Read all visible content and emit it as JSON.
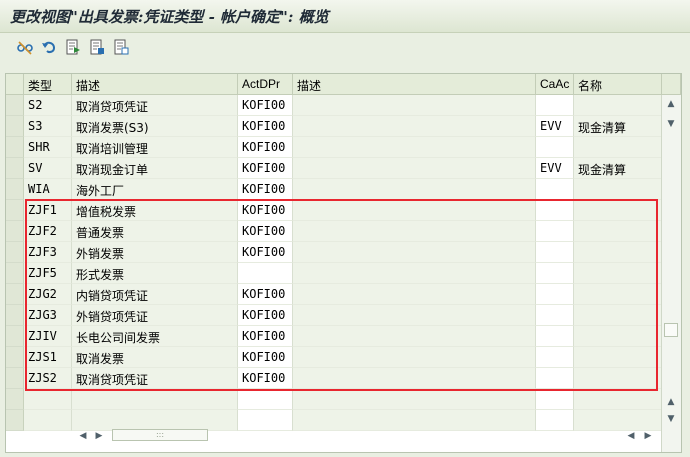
{
  "title": "更改视图\"出具发票:凭证类型 - 帐户确定\": 概览",
  "toolbar": [
    {
      "icon": "glasses-icon",
      "name": "display-change-button"
    },
    {
      "icon": "undo-icon",
      "name": "undo-button"
    },
    {
      "icon": "document-arrow-icon",
      "name": "export-button"
    },
    {
      "icon": "document-select-icon",
      "name": "select-all-button"
    },
    {
      "icon": "document-deselect-icon",
      "name": "deselect-button"
    }
  ],
  "table": {
    "headers": [
      "类型",
      "描述",
      "ActDPr",
      "描述",
      "CaAc",
      "名称"
    ],
    "rows": [
      {
        "type": "S2",
        "desc": "取消贷项凭证",
        "actdpr": "KOFI00",
        "desc2": "",
        "caac": "",
        "name": ""
      },
      {
        "type": "S3",
        "desc": "取消发票(S3)",
        "actdpr": "KOFI00",
        "desc2": "",
        "caac": "EVV",
        "name": "现金清算"
      },
      {
        "type": "SHR",
        "desc": "取消培训管理",
        "actdpr": "KOFI00",
        "desc2": "",
        "caac": "",
        "name": ""
      },
      {
        "type": "SV",
        "desc": "取消现金订单",
        "actdpr": "KOFI00",
        "desc2": "",
        "caac": "EVV",
        "name": "现金清算"
      },
      {
        "type": "WIA",
        "desc": "海外工厂",
        "actdpr": "KOFI00",
        "desc2": "",
        "caac": "",
        "name": ""
      },
      {
        "type": "ZJF1",
        "desc": "增值税发票",
        "actdpr": "KOFI00",
        "desc2": "",
        "caac": "",
        "name": ""
      },
      {
        "type": "ZJF2",
        "desc": "普通发票",
        "actdpr": "KOFI00",
        "desc2": "",
        "caac": "",
        "name": ""
      },
      {
        "type": "ZJF3",
        "desc": "外销发票",
        "actdpr": "KOFI00",
        "desc2": "",
        "caac": "",
        "name": ""
      },
      {
        "type": "ZJF5",
        "desc": "形式发票",
        "actdpr": "",
        "desc2": "",
        "caac": "",
        "name": ""
      },
      {
        "type": "ZJG2",
        "desc": "内销贷项凭证",
        "actdpr": "KOFI00",
        "desc2": "",
        "caac": "",
        "name": ""
      },
      {
        "type": "ZJG3",
        "desc": "外销贷项凭证",
        "actdpr": "KOFI00",
        "desc2": "",
        "caac": "",
        "name": ""
      },
      {
        "type": "ZJIV",
        "desc": "长电公司间发票",
        "actdpr": "KOFI00",
        "desc2": "",
        "caac": "",
        "name": ""
      },
      {
        "type": "ZJS1",
        "desc": "取消发票",
        "actdpr": "KOFI00",
        "desc2": "",
        "caac": "",
        "name": ""
      },
      {
        "type": "ZJS2",
        "desc": "取消贷项凭证",
        "actdpr": "KOFI00",
        "desc2": "",
        "caac": "",
        "name": ""
      },
      {
        "type": "",
        "desc": "",
        "actdpr": "",
        "desc2": "",
        "caac": "",
        "name": ""
      },
      {
        "type": "",
        "desc": "",
        "actdpr": "",
        "desc2": "",
        "caac": "",
        "name": ""
      }
    ]
  },
  "hscroll_grip": ":::",
  "colors": {
    "highlight_border": "#e8262f",
    "background": "#e9efe2",
    "header": "#e4ecd9"
  }
}
